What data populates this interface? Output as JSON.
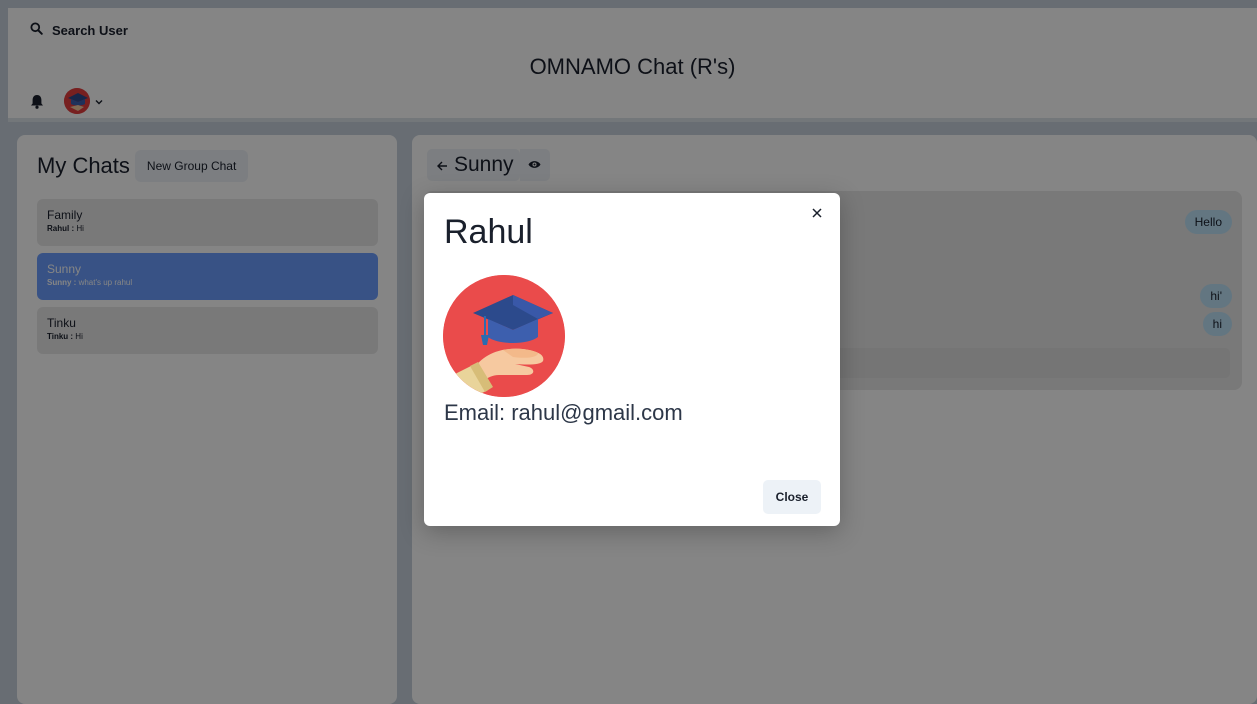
{
  "header": {
    "search_label": "Search User",
    "title": "OMNAMO Chat (R's)"
  },
  "chats": {
    "title": "My Chats",
    "new_group_label": "New Group Chat",
    "items": [
      {
        "name": "Family",
        "sender": "Rahul :",
        "message": " Hi",
        "active": false
      },
      {
        "name": "Sunny",
        "sender": "Sunny :",
        "message": " what's up rahul",
        "active": true
      },
      {
        "name": "Tinku",
        "sender": "Tinku :",
        "message": " Hi",
        "active": false
      }
    ]
  },
  "chatbox": {
    "chat_name": "Sunny",
    "messages": [
      "Hello",
      "hi'",
      "hi"
    ]
  },
  "modal": {
    "title": "Rahul",
    "email": "Email: rahul@gmail.com",
    "close_label": "Close"
  },
  "colors": {
    "active_chat": "#6b9eff",
    "bubble": "#bee3f8",
    "avatar_bg": "#ea4b4b"
  },
  "icons": [
    "search-icon",
    "bell-icon",
    "chevron-down-icon",
    "arrow-left-icon",
    "eye-icon",
    "close-icon"
  ]
}
